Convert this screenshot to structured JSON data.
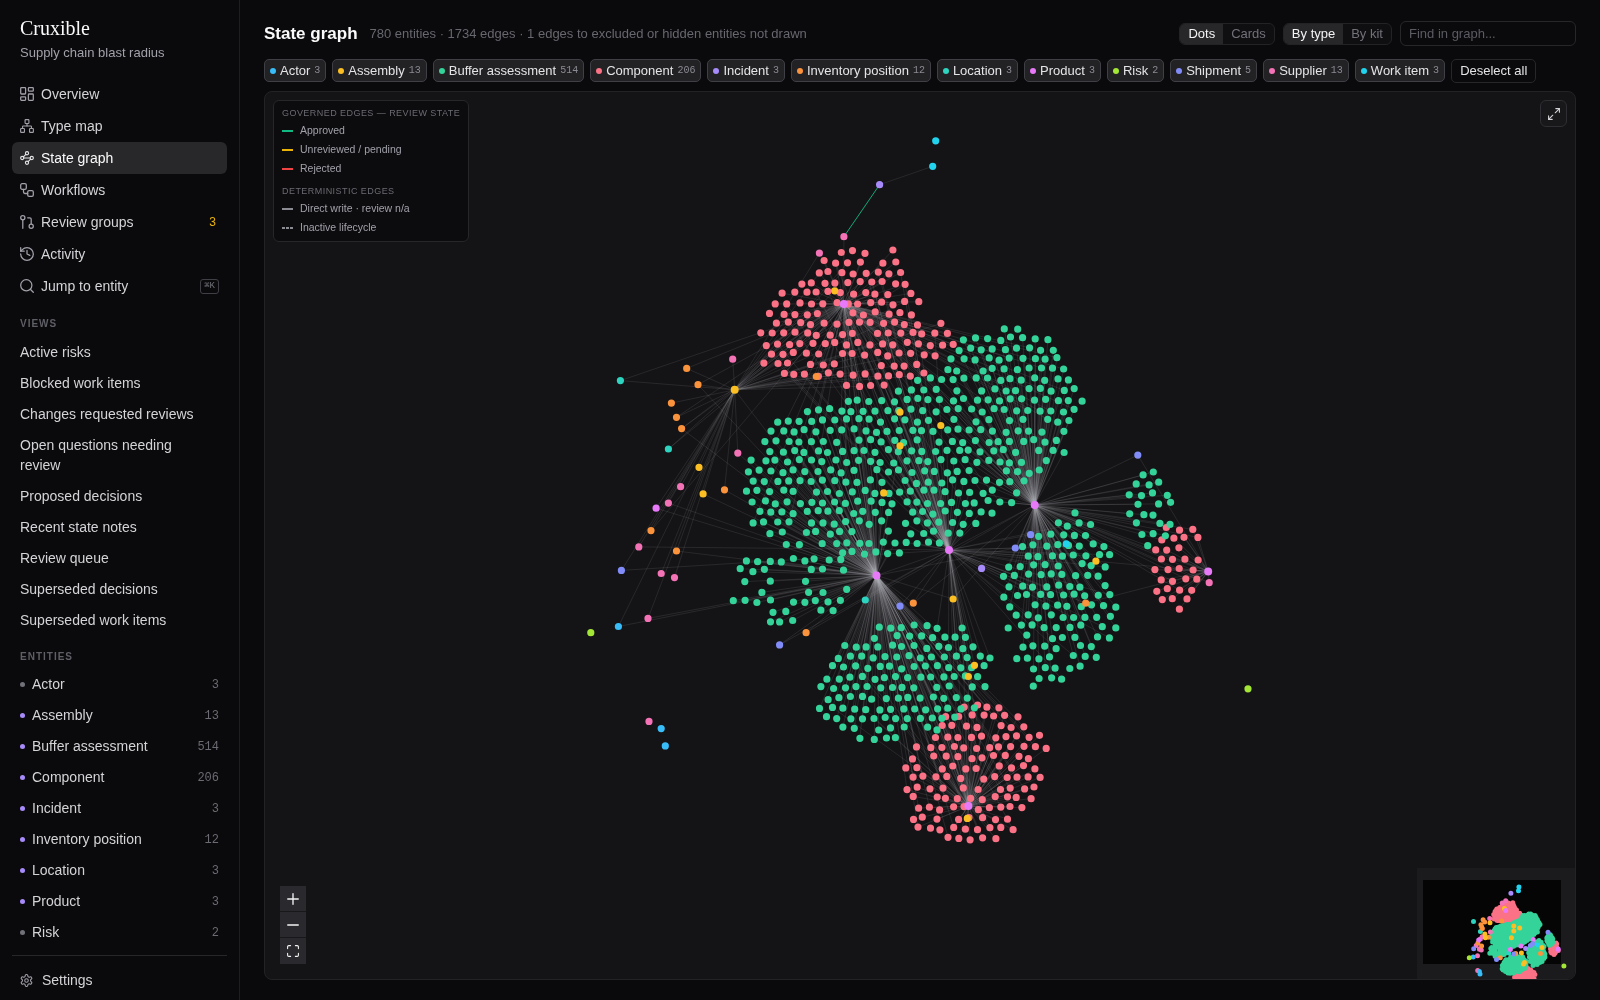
{
  "sidebar": {
    "app_name": "Cruxible",
    "workspace": "Supply chain blast radius",
    "nav": [
      {
        "label": "Overview",
        "selected": false
      },
      {
        "label": "Type map",
        "selected": false
      },
      {
        "label": "State graph",
        "selected": true
      },
      {
        "label": "Workflows",
        "selected": false
      },
      {
        "label": "Review groups",
        "selected": false,
        "badge": "3"
      },
      {
        "label": "Activity",
        "selected": false
      },
      {
        "label": "Jump to entity",
        "selected": false,
        "shortcut": "⌘K"
      }
    ],
    "views": {
      "heading": "VIEWS",
      "items": [
        "Active risks",
        "Blocked work items",
        "Changes requested reviews",
        "Open questions needing review",
        "Proposed decisions",
        "Recent state notes",
        "Review queue",
        "Superseded decisions",
        "Superseded work items"
      ]
    },
    "entities": {
      "heading": "ENTITIES",
      "items": [
        {
          "label": "Actor",
          "count": "3",
          "color": "#71717a"
        },
        {
          "label": "Assembly",
          "count": "13",
          "color": "#a78bfa"
        },
        {
          "label": "Buffer assessment",
          "count": "514",
          "color": "#a78bfa"
        },
        {
          "label": "Component",
          "count": "206",
          "color": "#a78bfa"
        },
        {
          "label": "Incident",
          "count": "3",
          "color": "#a78bfa"
        },
        {
          "label": "Inventory position",
          "count": "12",
          "color": "#a78bfa"
        },
        {
          "label": "Location",
          "count": "3",
          "color": "#a78bfa"
        },
        {
          "label": "Product",
          "count": "3",
          "color": "#a78bfa"
        },
        {
          "label": "Risk",
          "count": "2",
          "color": "#71717a"
        }
      ]
    },
    "settings": "Settings"
  },
  "header": {
    "title": "State graph",
    "summary": "780 entities · 1734 edges · 1 edges to excluded or hidden entities not drawn",
    "view_toggle": [
      {
        "label": "Dots",
        "selected": true
      },
      {
        "label": "Cards",
        "selected": false
      }
    ],
    "group_toggle": [
      {
        "label": "By type",
        "selected": true
      },
      {
        "label": "By kit",
        "selected": false
      }
    ],
    "search": {
      "placeholder": "Find in graph..."
    }
  },
  "type_filters": {
    "chips": [
      {
        "label": "Actor",
        "count": "3",
        "color": "#38bdf8",
        "selected": true
      },
      {
        "label": "Assembly",
        "count": "13",
        "color": "#fbbf24",
        "selected": true
      },
      {
        "label": "Buffer assessment",
        "count": "514",
        "color": "#34d399",
        "selected": true
      },
      {
        "label": "Component",
        "count": "206",
        "color": "#fb7185",
        "selected": true
      },
      {
        "label": "Incident",
        "count": "3",
        "color": "#a78bfa",
        "selected": true
      },
      {
        "label": "Inventory position",
        "count": "12",
        "color": "#fb923c",
        "selected": true
      },
      {
        "label": "Location",
        "count": "3",
        "color": "#2dd4bf",
        "selected": true
      },
      {
        "label": "Product",
        "count": "3",
        "color": "#e879f9",
        "selected": true
      },
      {
        "label": "Risk",
        "count": "2",
        "color": "#a3e635",
        "selected": true
      },
      {
        "label": "Shipment",
        "count": "5",
        "color": "#818cf8",
        "selected": true
      },
      {
        "label": "Supplier",
        "count": "13",
        "color": "#f472b6",
        "selected": true
      },
      {
        "label": "Work item",
        "count": "3",
        "color": "#22d3ee",
        "selected": true
      }
    ],
    "deselect_all": "Deselect all"
  },
  "graph": {
    "legend": {
      "sections": [
        {
          "heading": "GOVERNED EDGES — REVIEW STATE",
          "items": [
            {
              "label": "Approved",
              "color": "#10b981",
              "kind": "solid"
            },
            {
              "label": "Unreviewed / pending",
              "color": "#eab308",
              "kind": "solid"
            },
            {
              "label": "Rejected",
              "color": "#ef4444",
              "kind": "solid"
            }
          ]
        },
        {
          "heading": "DETERMINISTIC EDGES",
          "items": [
            {
              "label": "Direct write · review n/a",
              "color": "#8b8b93",
              "kind": "solid"
            },
            {
              "label": "Inactive lifecycle",
              "color": "#8b8b93",
              "kind": "dashed"
            }
          ]
        }
      ]
    }
  }
}
